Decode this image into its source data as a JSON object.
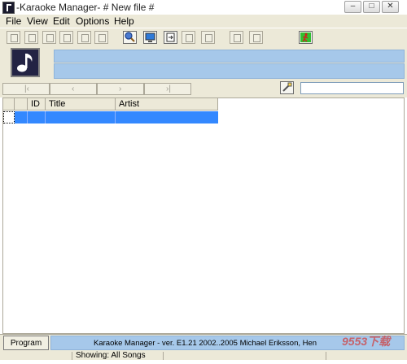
{
  "window": {
    "title": "-Karaoke Manager- # New file #",
    "minimize": "–",
    "maximize": "□",
    "close": "✕"
  },
  "menu": [
    "File",
    "View",
    "Edit",
    "Options",
    "Help"
  ],
  "toolbar": {
    "icons": [
      "tool1-icon",
      "tool2-icon",
      "tool3-icon",
      "tool4-icon",
      "tool5-icon",
      "tool6-icon",
      "search-icon",
      "monitor-icon",
      "import-icon",
      "edit-icon",
      "tool11-icon",
      "refresh-icon",
      "tool13-icon",
      "runner-icon"
    ]
  },
  "list": {
    "columns": [
      "ID",
      "Title",
      "Artist"
    ]
  },
  "search": {
    "value": ""
  },
  "bottom": {
    "program_info": "Program Info",
    "credits": "Karaoke Manager - ver. E1.21 2002..2005 Michael Eriksson, Hen"
  },
  "status": {
    "showing": "Showing: All Songs"
  },
  "watermark": "9553下载",
  "colors": {
    "info_panel": "#a6c8ea",
    "selection": "#3388ff",
    "window_bg": "#ece9d8"
  }
}
